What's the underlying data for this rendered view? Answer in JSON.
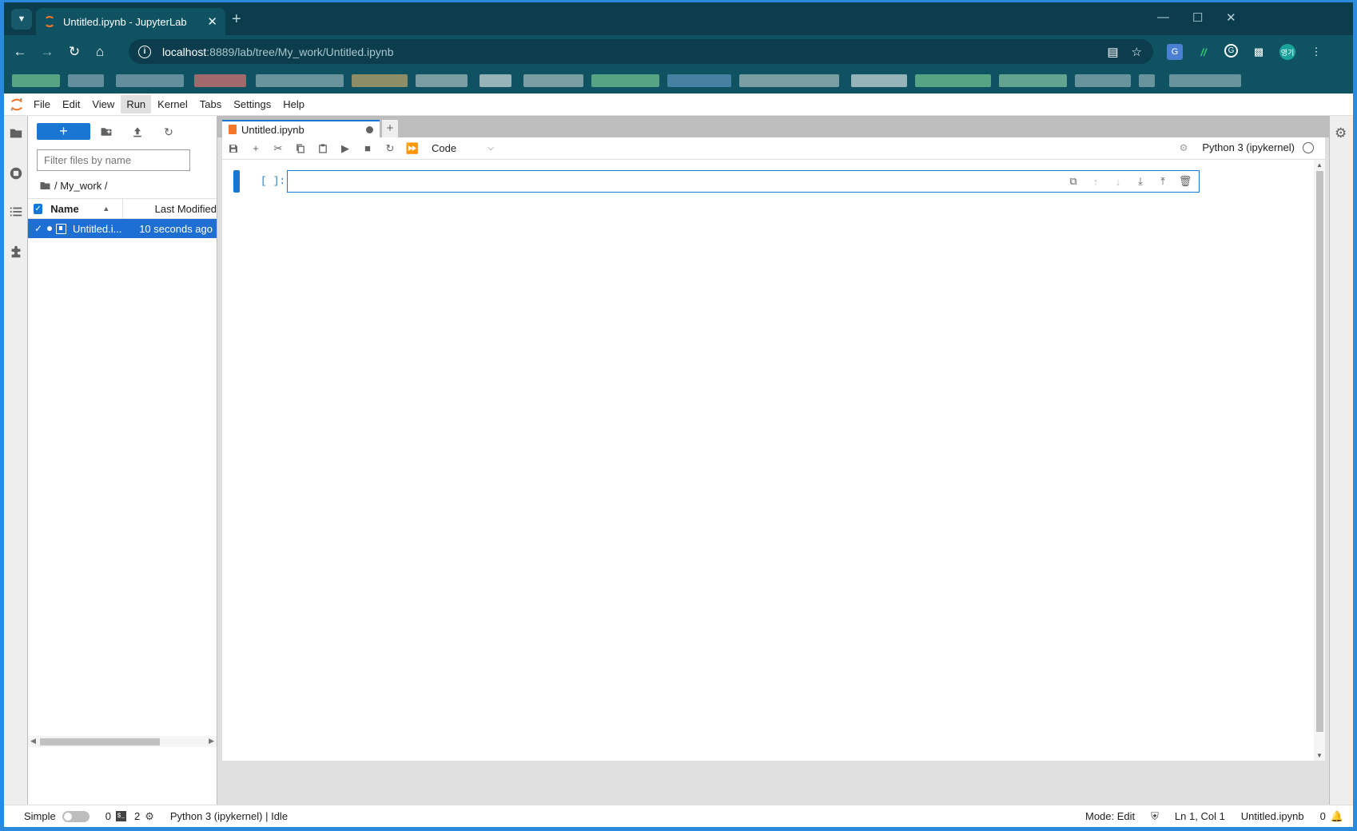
{
  "browser": {
    "tab_title": "Untitled.ipynb - JupyterLab",
    "url_host": "localhost",
    "url_path": ":8889/lab/tree/My_work/Untitled.ipynb",
    "profile_label": "영기"
  },
  "menubar": {
    "items": [
      "File",
      "Edit",
      "View",
      "Run",
      "Kernel",
      "Tabs",
      "Settings",
      "Help"
    ],
    "active": "Run"
  },
  "filebrowser": {
    "new_label": "+",
    "filter_placeholder": "Filter files by name",
    "breadcrumb": "/ My_work /",
    "col_name": "Name",
    "col_modified": "Last Modified",
    "files": [
      {
        "name": "Untitled.i...",
        "modified": "10 seconds ago",
        "selected": true,
        "running": true
      }
    ]
  },
  "notebook": {
    "tab_label": "Untitled.ipynb",
    "cell_type": "Code",
    "kernel_name": "Python 3 (ipykernel)",
    "cell_prompt": "[ ]:"
  },
  "statusbar": {
    "mode_label": "Simple",
    "terminals_count": "0",
    "kernels_count": "2",
    "kernel_status": "Python 3 (ipykernel) | Idle",
    "edit_mode": "Mode: Edit",
    "cursor": "Ln 1, Col 1",
    "filename": "Untitled.ipynb",
    "notifications": "0"
  },
  "colors": {
    "browser_frame": "#0b3d4c",
    "jupyter_accent": "#1976d2",
    "jupyter_orange": "#f37726"
  }
}
